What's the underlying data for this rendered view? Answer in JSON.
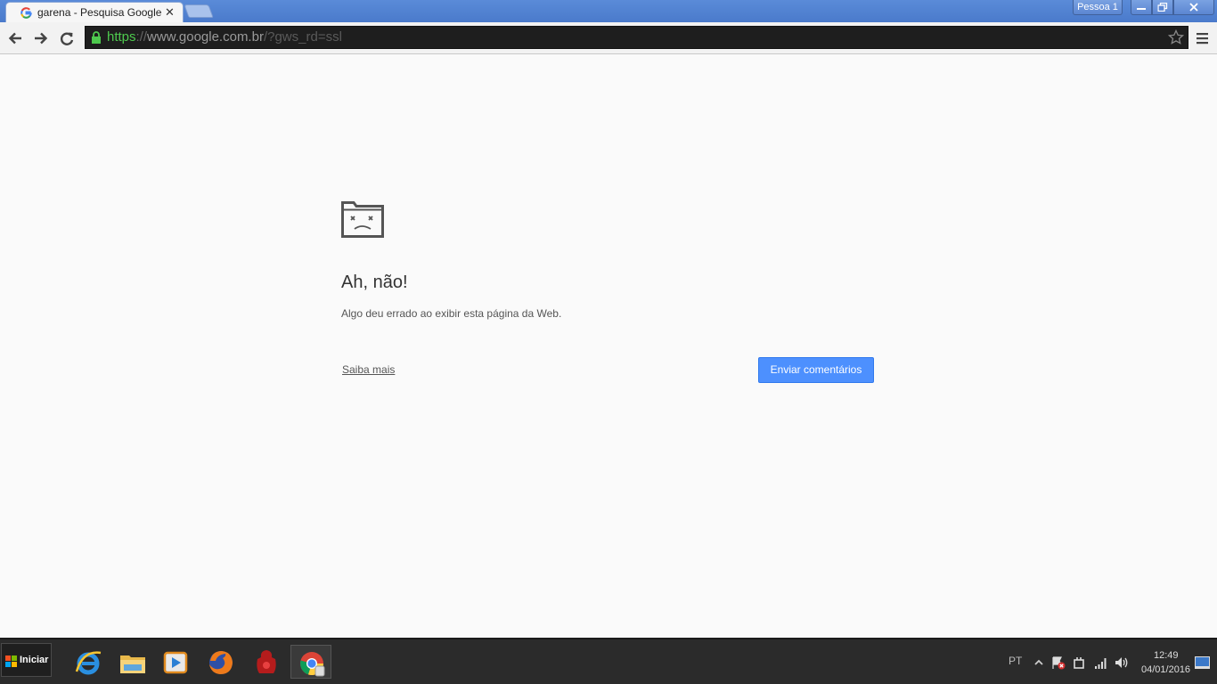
{
  "browser": {
    "tab": {
      "title": "garena - Pesquisa Google",
      "close_glyph": "✕"
    },
    "profile_label": "Pessoa 1",
    "url": {
      "scheme": "https",
      "sep": "://",
      "host": "www.google.com.br",
      "path": "/?gws_rd=ssl"
    }
  },
  "error_page": {
    "title": "Ah, não!",
    "message": "Algo deu errado ao exibir esta página da Web.",
    "learn_more": "Saiba mais",
    "feedback_button": "Enviar comentários"
  },
  "taskbar": {
    "start_label": "Iniciar",
    "apps": [
      "internet-explorer-icon",
      "file-explorer-icon",
      "media-player-icon",
      "firefox-icon",
      "garena-icon",
      "chrome-icon"
    ],
    "language": "PT",
    "clock": {
      "time": "12:49",
      "date": "04/01/2016"
    }
  },
  "colors": {
    "titlebar": "#4a7acb",
    "accent_button": "#4d90fe",
    "url_scheme": "#4ec94e",
    "taskbar": "#2b2b2b"
  }
}
